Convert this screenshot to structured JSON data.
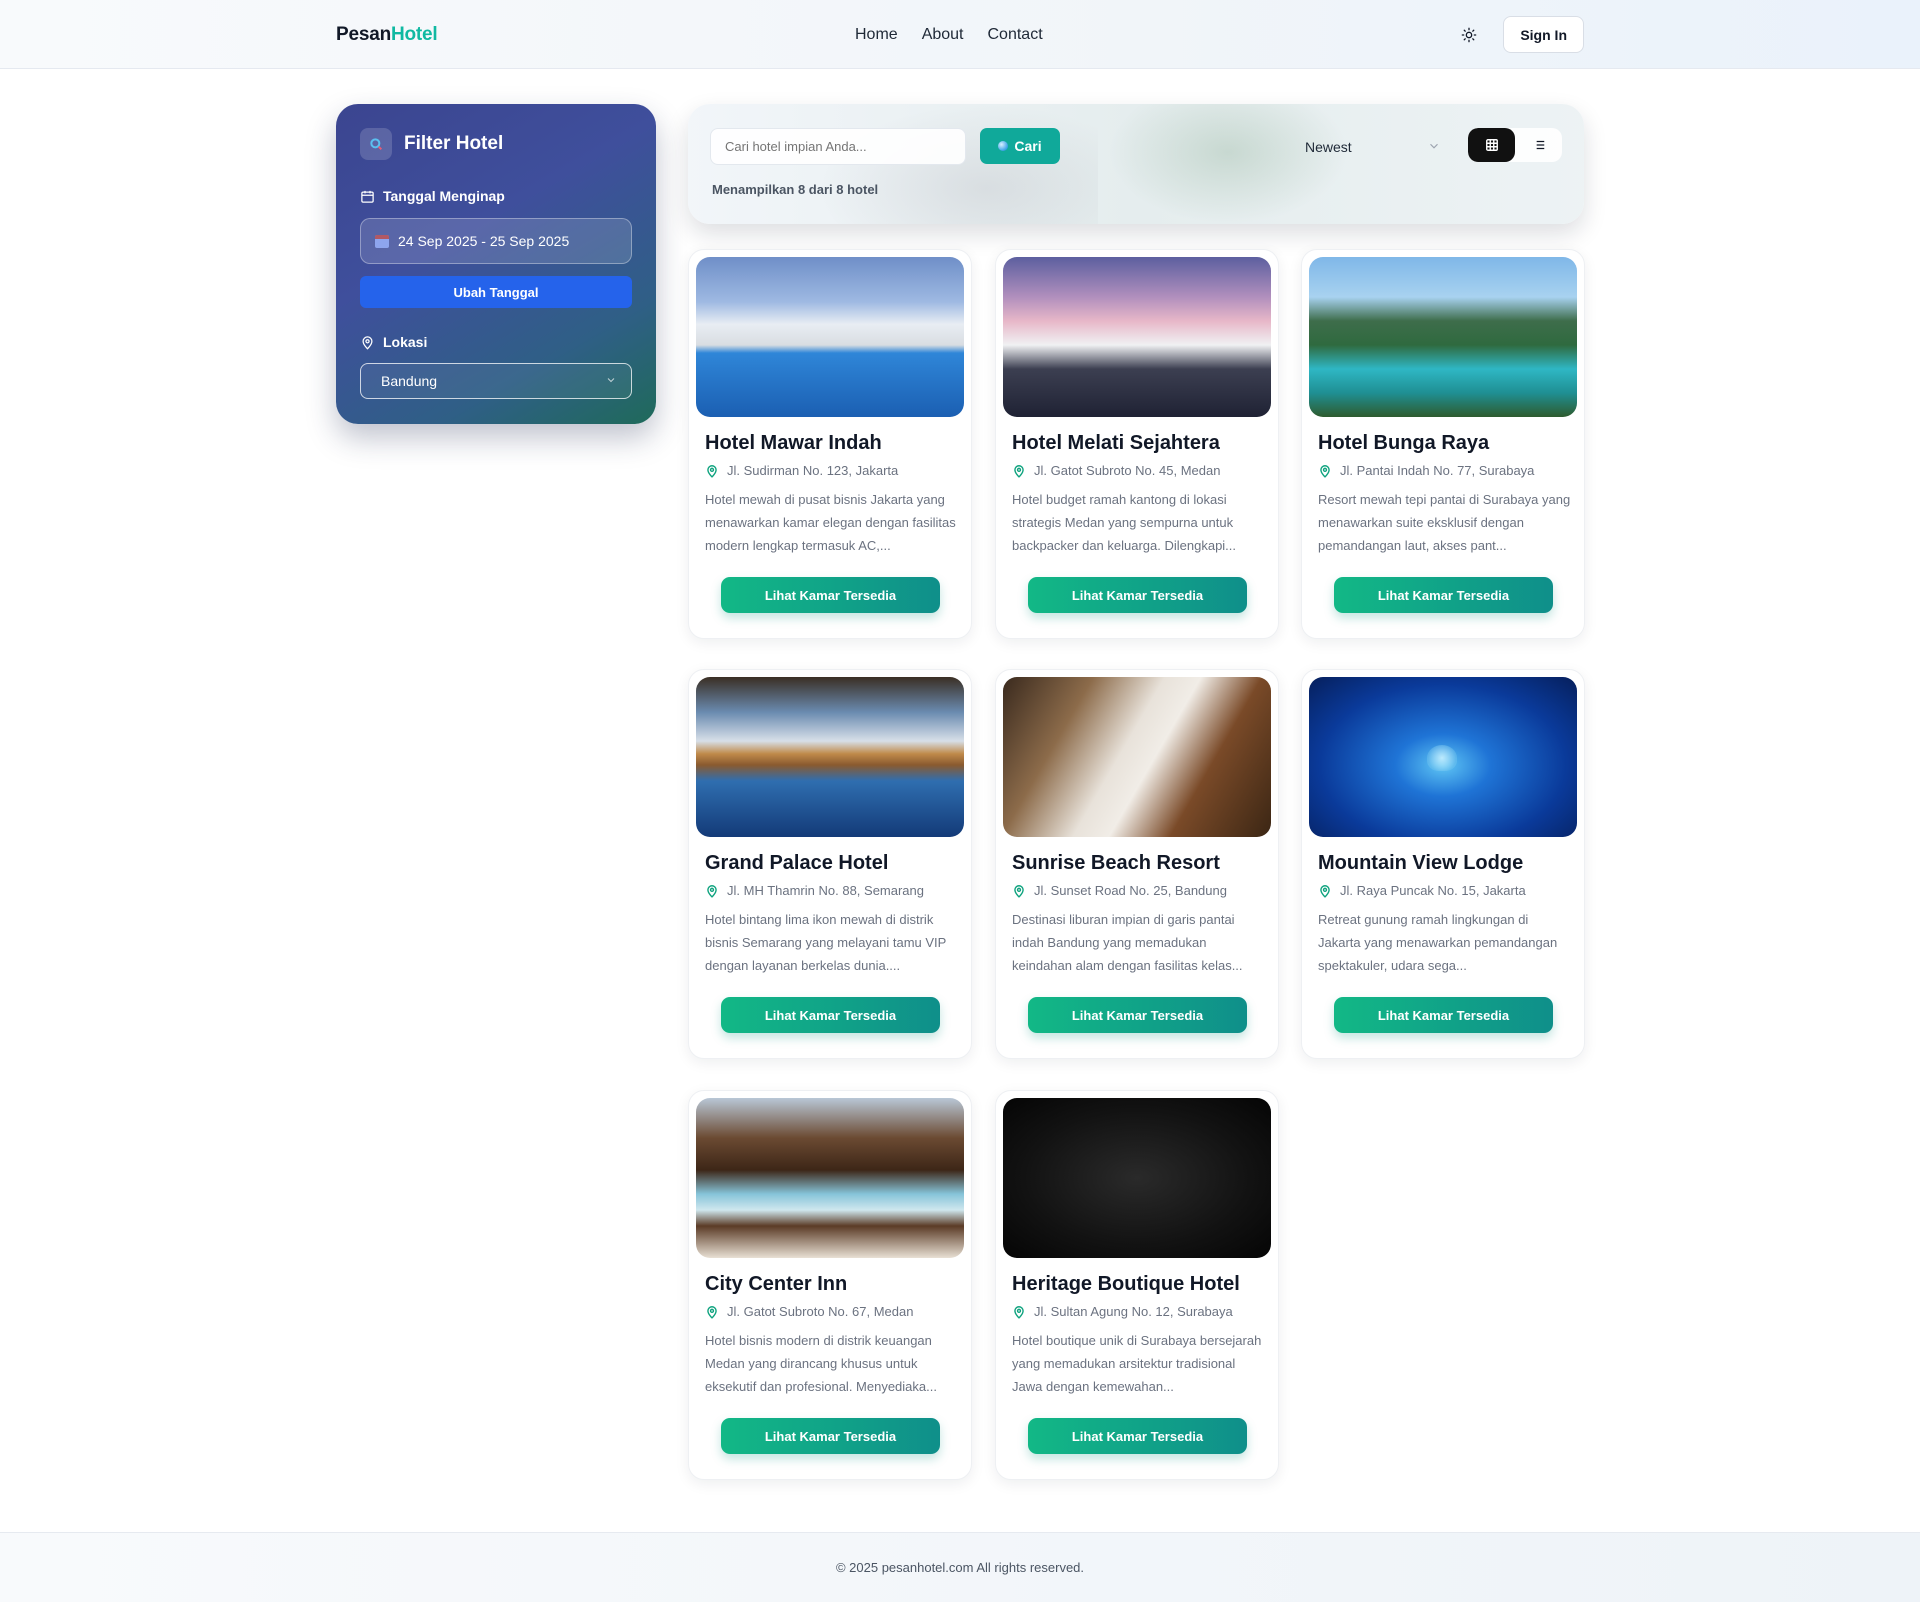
{
  "header": {
    "logo_part1": "Pesan",
    "logo_part2": "Hotel",
    "nav": [
      "Home",
      "About",
      "Contact"
    ],
    "signin_label": "Sign In"
  },
  "sidebar": {
    "title": "Filter Hotel",
    "date_label": "Tanggal Menginap",
    "date_value": "24 Sep 2025 - 25 Sep 2025",
    "change_date_label": "Ubah Tanggal",
    "location_label": "Lokasi",
    "location_value": "Bandung"
  },
  "search": {
    "placeholder": "Cari hotel impian Anda...",
    "button_label": "Cari",
    "sort_value": "Newest",
    "result_text": "Menampilkan 8 dari 8 hotel"
  },
  "cards": [
    {
      "name": "Hotel Mawar Indah",
      "address": "Jl. Sudirman No. 123, Jakarta",
      "description": "Hotel mewah di pusat bisnis Jakarta yang menawarkan kamar elegan dengan fasilitas modern lengkap termasuk AC,...",
      "button": "Lihat Kamar Tersedia"
    },
    {
      "name": "Hotel Melati Sejahtera",
      "address": "Jl. Gatot Subroto No. 45, Medan",
      "description": "Hotel budget ramah kantong di lokasi strategis Medan yang sempurna untuk backpacker dan keluarga. Dilengkapi...",
      "button": "Lihat Kamar Tersedia"
    },
    {
      "name": "Hotel Bunga Raya",
      "address": "Jl. Pantai Indah No. 77, Surabaya",
      "description": "Resort mewah tepi pantai di Surabaya yang menawarkan suite eksklusif dengan pemandangan laut, akses pant...",
      "button": "Lihat Kamar Tersedia"
    },
    {
      "name": "Grand Palace Hotel",
      "address": "Jl. MH Thamrin No. 88, Semarang",
      "description": "Hotel bintang lima ikon mewah di distrik bisnis Semarang yang melayani tamu VIP dengan layanan berkelas dunia....",
      "button": "Lihat Kamar Tersedia"
    },
    {
      "name": "Sunrise Beach Resort",
      "address": "Jl. Sunset Road No. 25, Bandung",
      "description": "Destinasi liburan impian di garis pantai indah Bandung yang memadukan keindahan alam dengan fasilitas kelas...",
      "button": "Lihat Kamar Tersedia"
    },
    {
      "name": "Mountain View Lodge",
      "address": "Jl. Raya Puncak No. 15, Jakarta",
      "description": "Retreat gunung ramah lingkungan di Jakarta yang menawarkan pemandangan spektakuler, udara sega...",
      "button": "Lihat Kamar Tersedia"
    },
    {
      "name": "City Center Inn",
      "address": "Jl. Gatot Subroto No. 67, Medan",
      "description": "Hotel bisnis modern di distrik keuangan Medan yang dirancang khusus untuk eksekutif dan profesional. Menyediaka...",
      "button": "Lihat Kamar Tersedia"
    },
    {
      "name": "Heritage Boutique Hotel",
      "address": "Jl. Sultan Agung No. 12, Surabaya",
      "description": "Hotel boutique unik di Surabaya bersejarah yang memadukan arsitektur tradisional Jawa dengan kemewahan...",
      "button": "Lihat Kamar Tersedia"
    }
  ],
  "footer": {
    "copyright": "© 2025 pesanhotel.com All rights reserved."
  },
  "colors": {
    "brand_teal": "#10b9a2",
    "button_green": "#12b886",
    "primary_blue": "#2563eb"
  }
}
